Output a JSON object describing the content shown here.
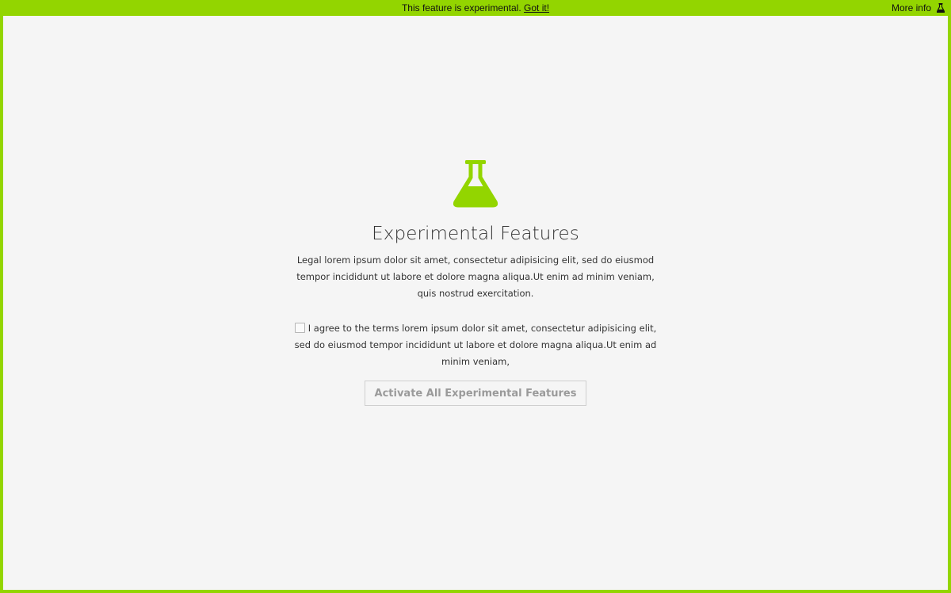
{
  "banner": {
    "message": "This feature is experimental.",
    "got_it_link": "Got it!",
    "more_info": "More info",
    "more_info_icon": "flask-icon"
  },
  "main": {
    "icon": "flask-icon",
    "title": "Experimental Features",
    "description": "Legal lorem ipsum dolor sit amet, consectetur adipisicing elit, sed do eiusmod tempor incididunt ut labore et dolore magna aliqua.Ut enim ad minim veniam, quis nostrud exercitation.",
    "agree_text": "I agree to the terms lorem ipsum dolor sit amet, consectetur adipisicing elit, sed do eiusmod tempor incididunt ut labore et dolore magna aliqua.Ut enim ad minim veniam,",
    "agree_checked": false,
    "activate_button": "Activate All Experimental Features",
    "activate_enabled": false
  },
  "colors": {
    "accent": "#93d500",
    "background": "#f5f5f5",
    "text": "#333333",
    "disabled_text": "#9a9a9a"
  }
}
